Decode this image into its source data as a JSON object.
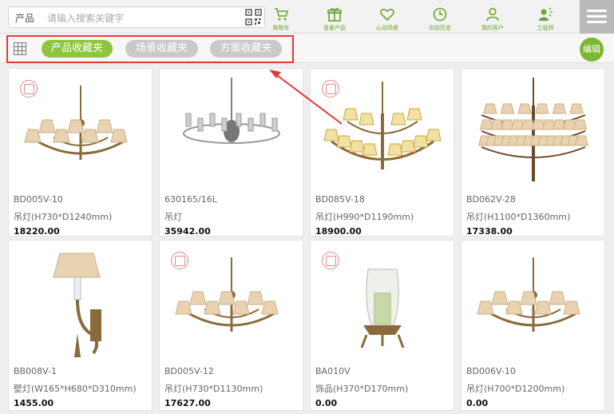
{
  "search": {
    "category": "产品",
    "placeholder": "请输入搜索关键字"
  },
  "nav": [
    {
      "label": "购物车",
      "icon": "cart-icon"
    },
    {
      "label": "喜爱产品",
      "icon": "gift-icon"
    },
    {
      "label": "心动场景",
      "icon": "heart-icon"
    },
    {
      "label": "浏览历史",
      "icon": "clock-icon"
    },
    {
      "label": "我的客户",
      "icon": "user-icon"
    },
    {
      "label": "工程师",
      "icon": "engineer-icon"
    }
  ],
  "tabs": [
    {
      "label": "产品收藏夹",
      "active": true
    },
    {
      "label": "场景收藏夹",
      "active": false
    },
    {
      "label": "方案收藏夹",
      "active": false
    }
  ],
  "edit_label": "编辑",
  "colors": {
    "accent": "#8cc63f",
    "highlight": "#e53935",
    "inactive_tab": "#c9c9c9"
  },
  "products": [
    {
      "code": "BD005V-10",
      "desc": "吊灯(H730*D1240mm)",
      "price": "18220.00",
      "seal": true,
      "kind": "chandelier-shades"
    },
    {
      "code": "630165/16L",
      "desc": "吊灯",
      "price": "35942.00",
      "seal": false,
      "kind": "chandelier-crystal"
    },
    {
      "code": "BD085V-18",
      "desc": "吊灯(H990*D1190mm)",
      "price": "18900.00",
      "seal": true,
      "kind": "chandelier-gold"
    },
    {
      "code": "BD062V-28",
      "desc": "吊灯(H1100*D1360mm)",
      "price": "17338.00",
      "seal": false,
      "kind": "chandelier-tiered"
    },
    {
      "code": "BB008V-1",
      "desc": "壁灯(W165*H680*D310mm)",
      "price": "1455.00",
      "seal": false,
      "kind": "wall-lamp"
    },
    {
      "code": "BD005V-12",
      "desc": "吊灯(H730*D1130mm)",
      "price": "17627.00",
      "seal": true,
      "kind": "chandelier-shades"
    },
    {
      "code": "BA010V",
      "desc": "饰品(H370*D170mm)",
      "price": "0.00",
      "seal": true,
      "kind": "hurricane-candle"
    },
    {
      "code": "BD006V-10",
      "desc": "吊灯(H700*D1200mm)",
      "price": "0.00",
      "seal": false,
      "kind": "chandelier-small"
    }
  ]
}
